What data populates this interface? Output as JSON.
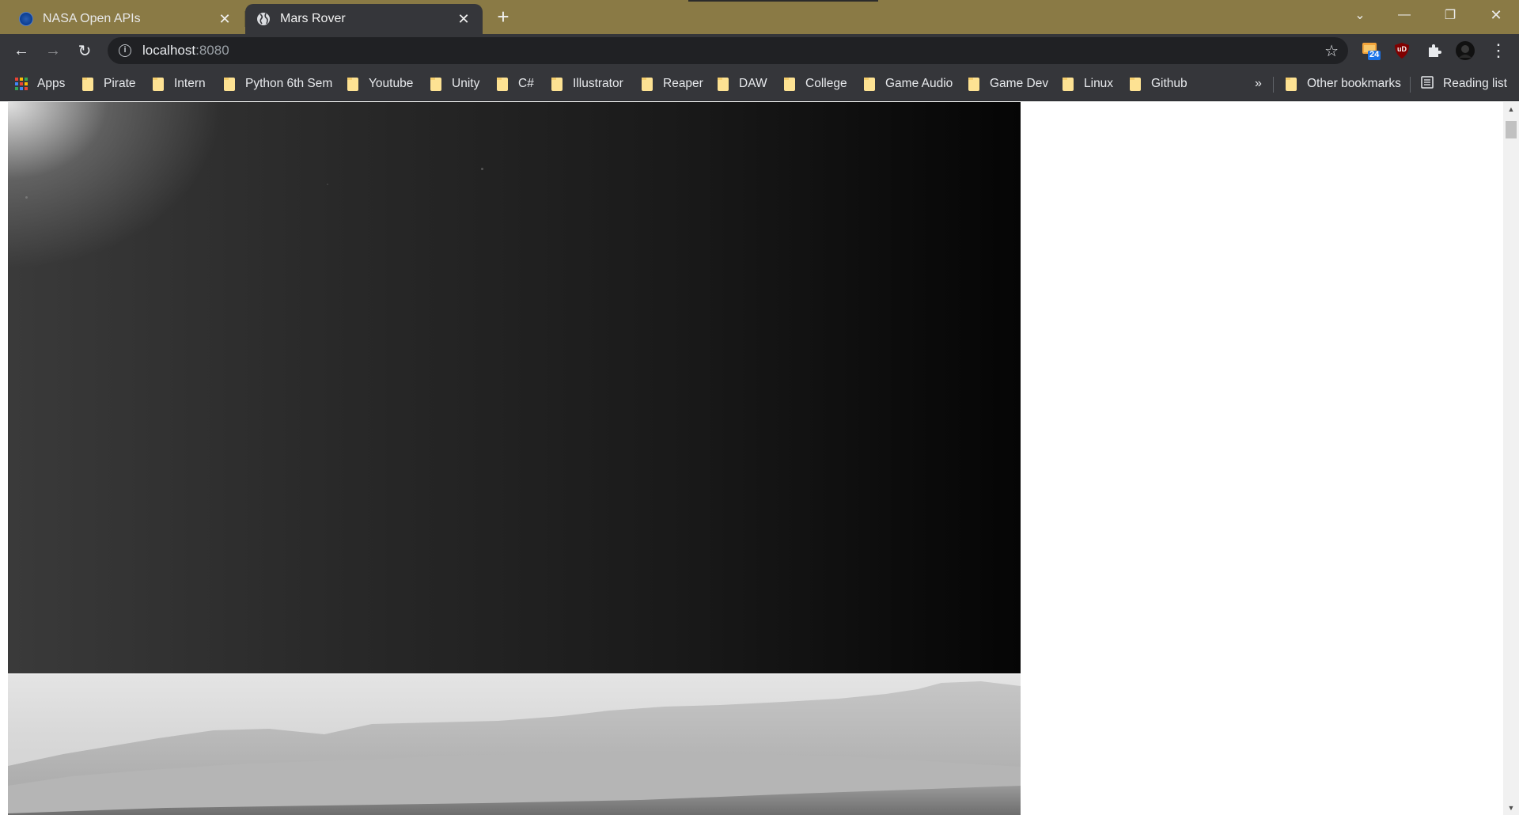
{
  "tabs": [
    {
      "title": "NASA Open APIs",
      "favicon": "nasa-logo-icon",
      "active": false
    },
    {
      "title": "Mars Rover",
      "favicon": "globe-icon",
      "active": true
    }
  ],
  "new_tab_symbol": "+",
  "window_controls": {
    "tab_search": "⌄",
    "minimize": "—",
    "restore": "❐",
    "close": "✕"
  },
  "toolbar": {
    "back": "←",
    "forward": "→",
    "reload": "↻",
    "url_host": "localhost",
    "url_port": ":8080",
    "bookmark_star": "☆",
    "extensions": [
      {
        "name": "calendar-extension",
        "badge": "24"
      },
      {
        "name": "ublock-extension",
        "label": "uD"
      },
      {
        "name": "extensions-puzzle",
        "label": ""
      },
      {
        "name": "profile-avatar",
        "label": ""
      }
    ],
    "menu": "⋮"
  },
  "bookmarks": {
    "apps_label": "Apps",
    "items": [
      "Pirate",
      "Intern",
      "Python 6th Sem",
      "Youtube",
      "Unity",
      "C#",
      "Illustrator",
      "Reaper",
      "DAW",
      "College",
      "Game Audio",
      "Game Dev",
      "Linux",
      "Github"
    ],
    "overflow": "»",
    "other_label": "Other bookmarks",
    "reading_list_label": "Reading list"
  },
  "colors": {
    "frame": "#8a7a45",
    "toolbar": "#35363a",
    "omnibox": "#202124",
    "folder": "#fde293"
  }
}
